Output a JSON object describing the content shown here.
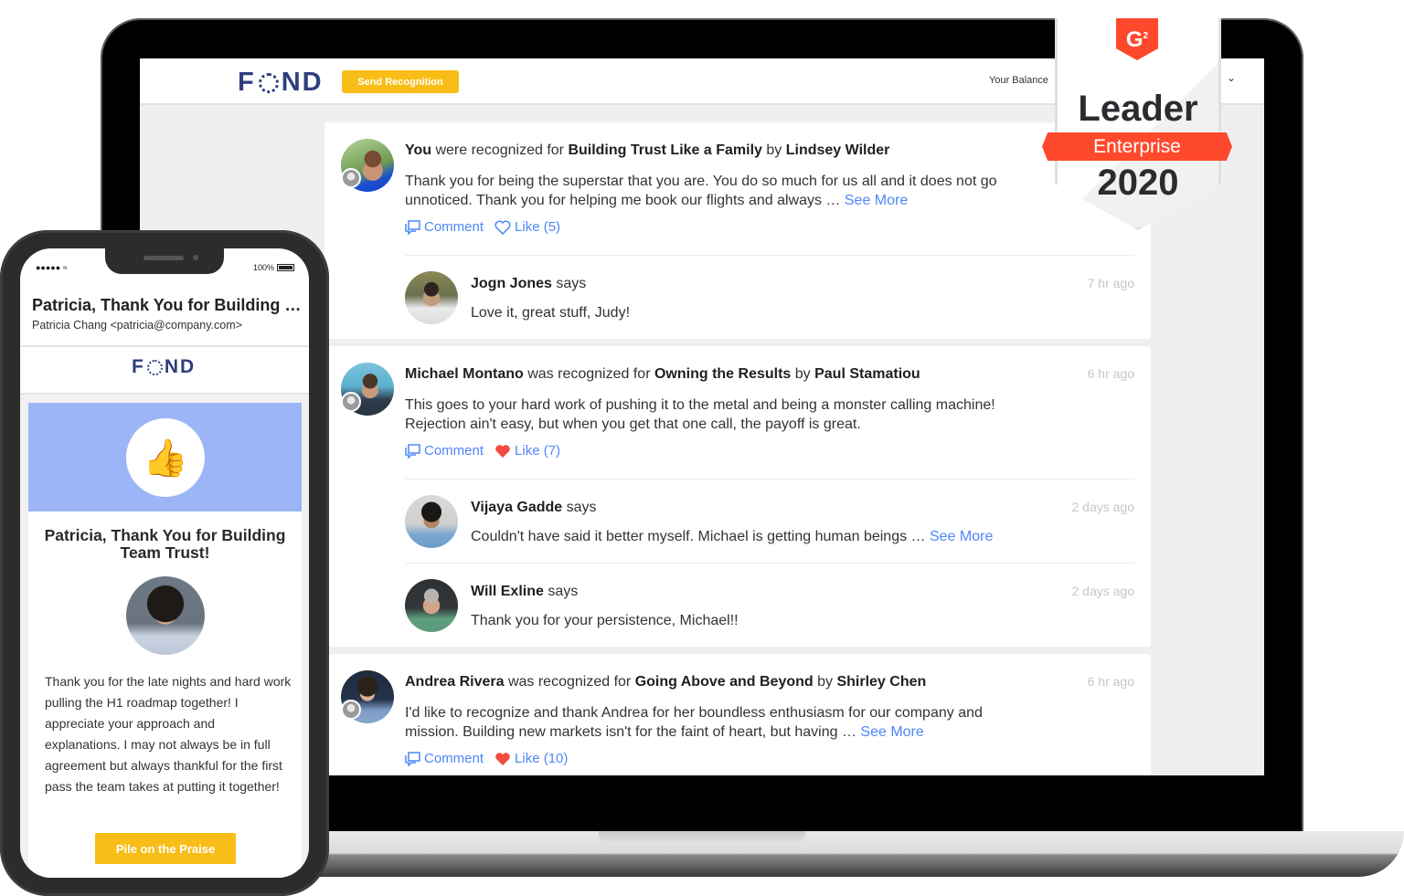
{
  "app": {
    "brand": "FOND",
    "brand_parts": {
      "before": "F",
      "after": "ND"
    },
    "colors": {
      "brand": "#2d3f7e",
      "accent_yellow": "#f8bd16",
      "link_blue": "#4f86f7",
      "like_red": "#f04b3e",
      "g2_red": "#ff492c",
      "hero_blue": "#9cb5f7"
    }
  },
  "topbar": {
    "send_recognition_label": "Send Recognition",
    "balance_label": "Your Balance",
    "user_menu_icon": "chevron-down-icon"
  },
  "feed": [
    {
      "recipient": "You",
      "verb": " were recognized for ",
      "award": "Building Trust Like a Family",
      "by": " by ",
      "giver": "Lindsey Wilder",
      "time": "",
      "text": "Thank you for being the superstar that you are. You do so much for us all and it does not go unnoticed. Thank you for helping me book our flights and always … ",
      "see_more": "See More",
      "comment_label": "Comment",
      "like_label": "Like (5)",
      "liked": false,
      "comments": [
        {
          "name": "Jogn Jones",
          "says": " says",
          "time": "7 hr ago",
          "text": "Love it, great stuff, Judy!",
          "see_more": ""
        }
      ]
    },
    {
      "recipient": "Michael Montano",
      "verb": " was recognized for ",
      "award": "Owning the Results",
      "by": " by ",
      "giver": "Paul Stamatiou",
      "time": "6 hr ago",
      "text": "This goes to your hard work of pushing it to the metal and being a monster calling machine! Rejection ain't easy, but when you get that one call, the payoff is great.",
      "see_more": "",
      "comment_label": "Comment",
      "like_label": "Like (7)",
      "liked": true,
      "comments": [
        {
          "name": "Vijaya Gadde",
          "says": " says",
          "time": "2 days ago",
          "text": "Couldn't have said it better myself.  Michael is getting human beings … ",
          "see_more": "See More"
        },
        {
          "name": "Will Exline",
          "says": " says",
          "time": "2 days ago",
          "text": "Thank you for your persistence, Michael!!",
          "see_more": ""
        }
      ]
    },
    {
      "recipient": "Andrea Rivera",
      "verb": " was recognized for ",
      "award": "Going Above and Beyond",
      "by": " by ",
      "giver": "Shirley Chen",
      "time": "6 hr ago",
      "text": "I'd like to recognize and thank Andrea for her boundless enthusiasm for our company and mission. Building new markets isn't for the faint of heart, but having … ",
      "see_more": "See More",
      "comment_label": "Comment",
      "like_label": "Like (10)",
      "liked": true,
      "comments": []
    }
  ],
  "g2_badge": {
    "logo": "G",
    "logo_sup": "2",
    "title": "Leader",
    "ribbon": "Enterprise",
    "year": "2020"
  },
  "phone": {
    "status": {
      "signal": "●●●●●",
      "wifi_icon": "wifi-icon",
      "battery": "100%"
    },
    "email": {
      "subject": "Patricia, Thank You for Building Team Trust!",
      "from": "Patricia Chang <patricia@company.com>",
      "title": "Patricia, Thank You for Building Team Trust!",
      "hero_icon": "thumbs-up-icon",
      "message": "Thank you for the late nights and hard work pulling the H1 roadmap together! I appreciate your approach and explanations. I may not always be in full agreement but always thankful for the first pass the team takes at putting it together!",
      "cta_label": "Pile on the Praise"
    }
  }
}
